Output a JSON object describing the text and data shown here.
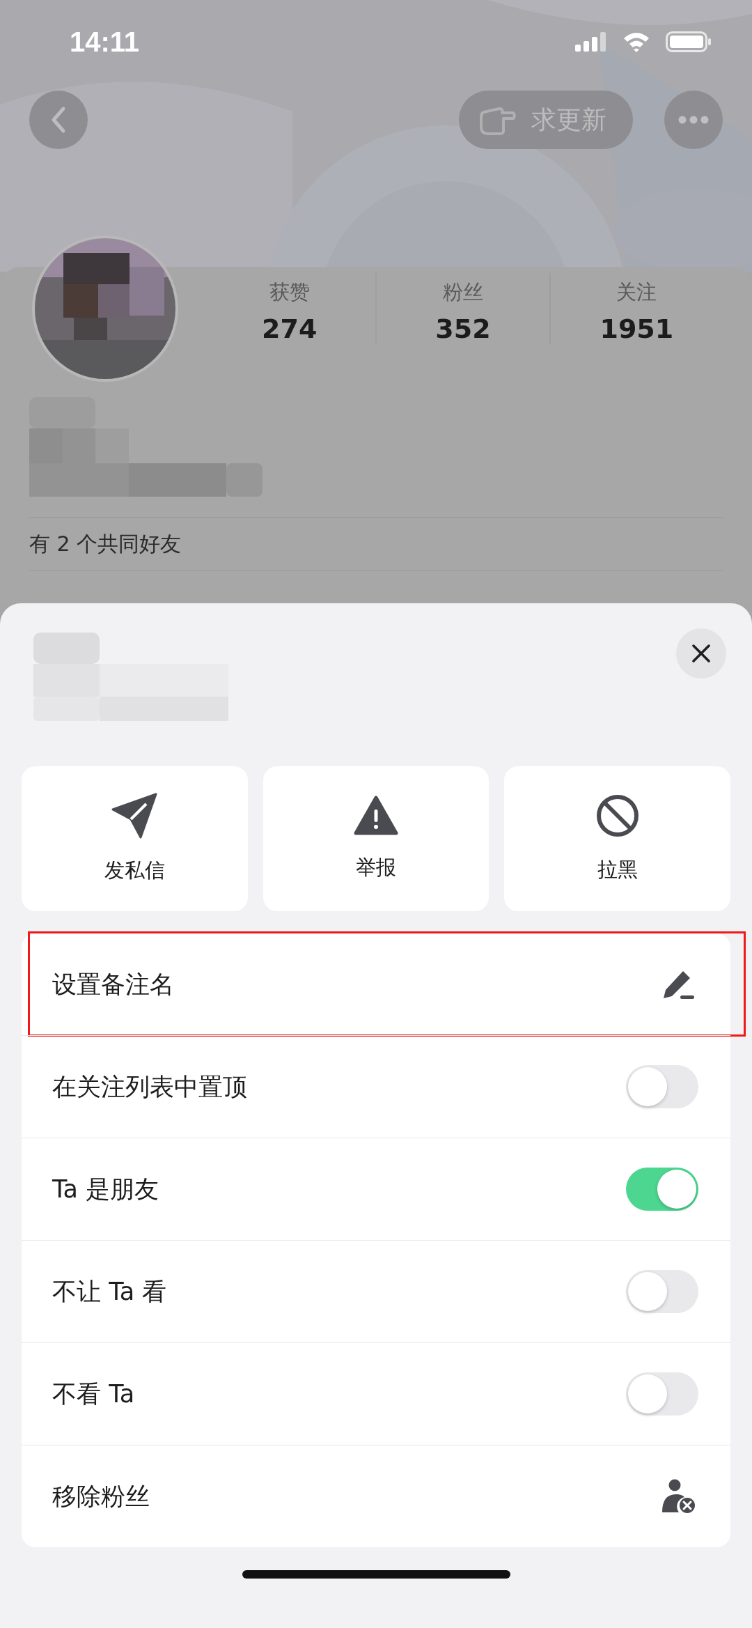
{
  "status_bar": {
    "time": "14:11"
  },
  "top_bar": {
    "request_update": "求更新"
  },
  "profile": {
    "stats": [
      {
        "label": "获赞",
        "value": "274"
      },
      {
        "label": "粉丝",
        "value": "352"
      },
      {
        "label": "关注",
        "value": "1951"
      }
    ],
    "mutual_friends": "有 2 个共同好友"
  },
  "sheet": {
    "actions": [
      {
        "label": "发私信",
        "kind": "send"
      },
      {
        "label": "举报",
        "kind": "warning"
      },
      {
        "label": "拉黑",
        "kind": "block"
      }
    ],
    "rows": [
      {
        "label": "设置备注名",
        "kind": "edit",
        "highlighted": true
      },
      {
        "label": "在关注列表中置顶",
        "kind": "toggle",
        "on": false
      },
      {
        "label": "Ta 是朋友",
        "kind": "toggle",
        "on": true
      },
      {
        "label": "不让 Ta 看",
        "kind": "toggle",
        "on": false
      },
      {
        "label": "不看 Ta",
        "kind": "toggle",
        "on": false
      },
      {
        "label": "移除粉丝",
        "kind": "remove"
      }
    ]
  }
}
